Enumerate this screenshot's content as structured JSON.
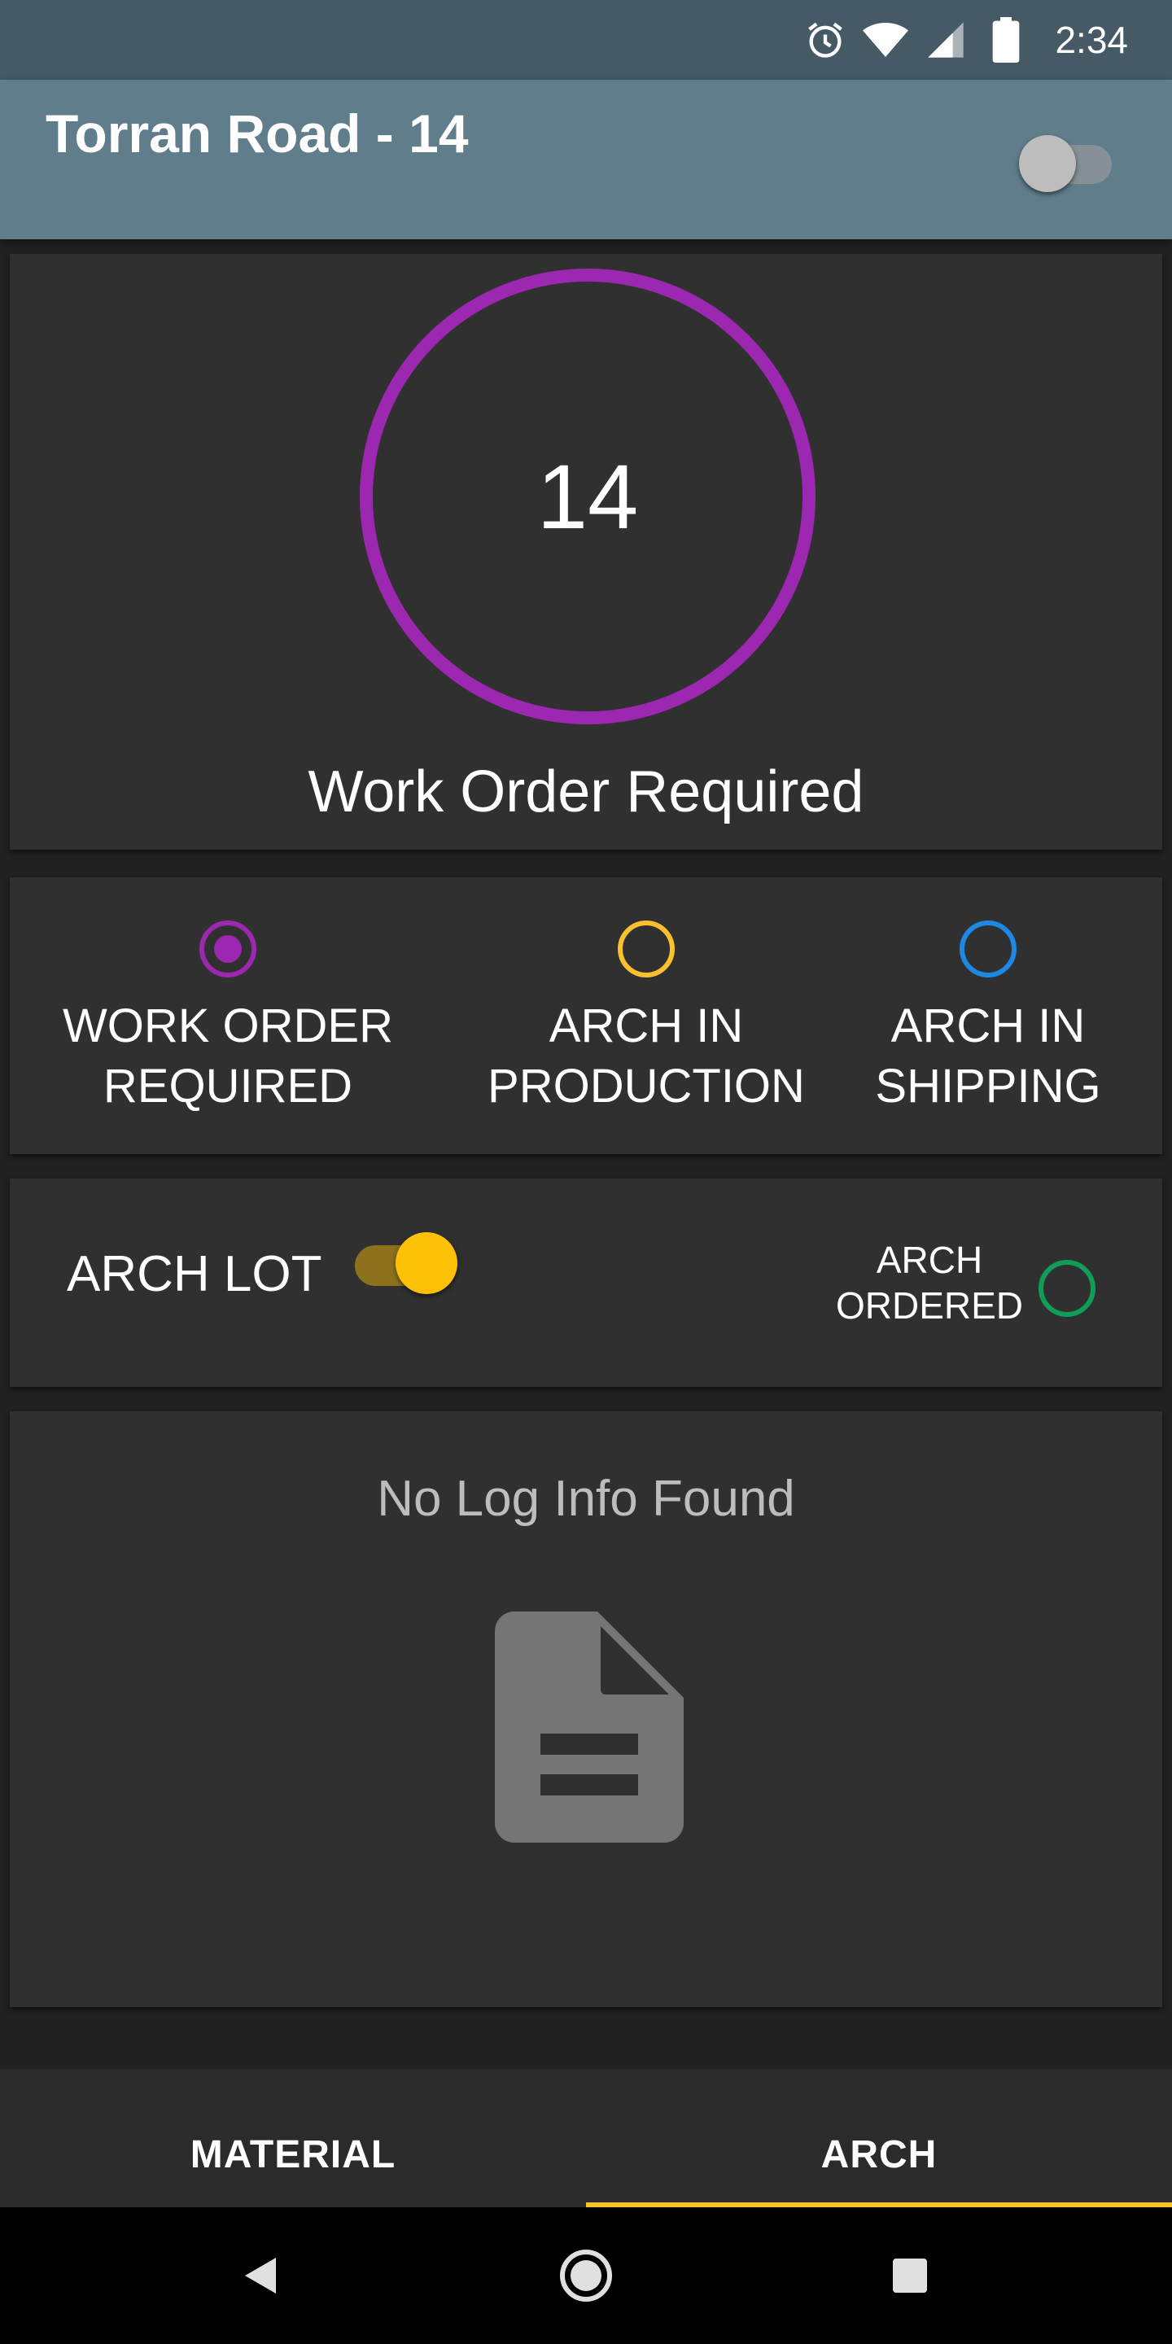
{
  "status_bar": {
    "time": "2:34",
    "icons": [
      "alarm-icon",
      "wifi-icon",
      "cell-signal-icon",
      "battery-icon"
    ]
  },
  "app_bar": {
    "title": "Torran Road - 14",
    "switch_on": false
  },
  "summary": {
    "count": "14",
    "label": "Work Order Required",
    "ring_color": "#9c27b0"
  },
  "legend": [
    {
      "label": "WORK ORDER\nREQUIRED",
      "color": "#9c27b0",
      "selected": true
    },
    {
      "label": "ARCH IN\nPRODUCTION",
      "color": "#fbc02d",
      "selected": false
    },
    {
      "label": "ARCH IN\nSHIPPING",
      "color": "#1e88e5",
      "selected": false
    }
  ],
  "arch_lot": {
    "label": "ARCH LOT",
    "toggle_on": true,
    "accent": "#ffc107",
    "ordered_label": "ARCH\nORDERED",
    "ordered_color": "#0f9d58"
  },
  "log": {
    "empty_text": "No Log Info Found",
    "icon": "document-icon"
  },
  "tabs": [
    {
      "label": "MATERIAL",
      "active": false
    },
    {
      "label": "ARCH",
      "active": true
    }
  ],
  "tab_indicator_color": "#fbc02d",
  "nav": [
    "back-icon",
    "home-icon",
    "recents-icon"
  ]
}
